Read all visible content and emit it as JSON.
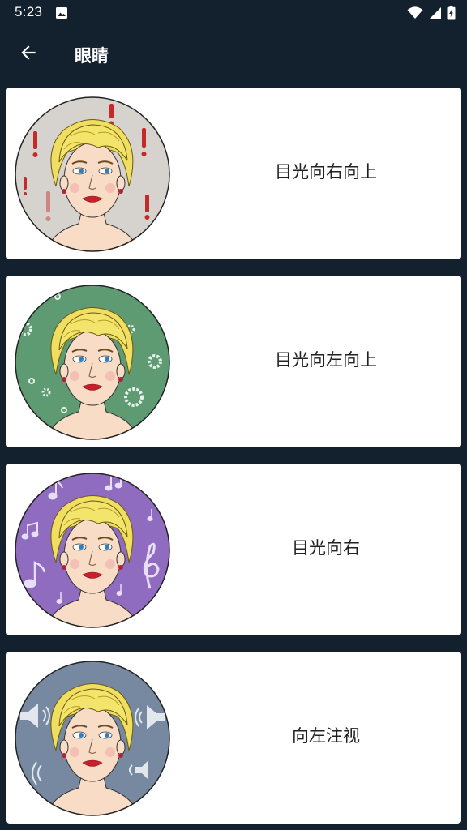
{
  "status_bar": {
    "time": "5:23",
    "icons": [
      "photo-icon",
      "wifi-icon",
      "signal-icon",
      "battery-icon"
    ]
  },
  "header": {
    "back_icon": "arrow-left-icon",
    "title": "眼睛"
  },
  "items": [
    {
      "label": "目光向右向上",
      "bg_color": "#d6d2cd",
      "decor": "exclamation-marks"
    },
    {
      "label": "目光向左向上",
      "bg_color": "#5e9a72",
      "decor": "gears"
    },
    {
      "label": "目光向右",
      "bg_color": "#8f6cc0",
      "decor": "music-notes"
    },
    {
      "label": "向左注视",
      "bg_color": "#7689a1",
      "decor": "speakers"
    }
  ],
  "colors": {
    "background": "#13202e",
    "card": "#ffffff",
    "text": "#222222"
  }
}
